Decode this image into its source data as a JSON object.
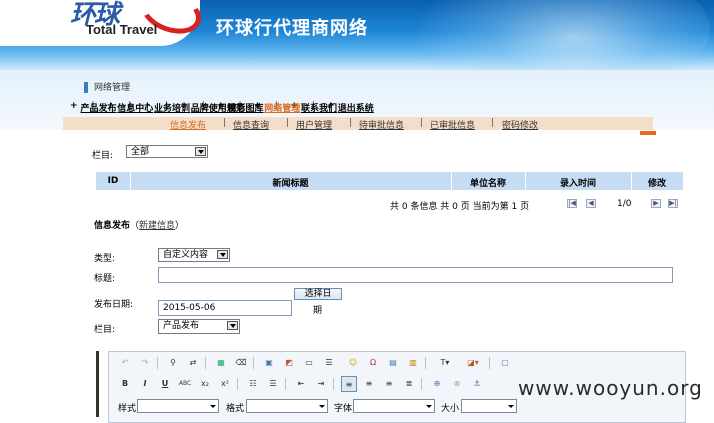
{
  "header": {
    "logo_mark": "环球",
    "logo_text": "Total Travel",
    "site_title": "环球行代理商网络"
  },
  "section_label": "网络管理",
  "nav": [
    {
      "label": "产品发布",
      "active": false
    },
    {
      "label": "信息中心",
      "active": false
    },
    {
      "label": "业务培训",
      "active": false
    },
    {
      "label": "品牌使用规范",
      "active": false
    },
    {
      "label": "精彩图库",
      "active": false
    },
    {
      "label": "网络管理",
      "active": true
    },
    {
      "label": "联系我们",
      "active": false
    },
    {
      "label": "退出系统",
      "active": false
    }
  ],
  "subnav": [
    {
      "label": "信息发布",
      "active": true
    },
    {
      "label": "信息查询",
      "active": false
    },
    {
      "label": "用户管理",
      "active": false
    },
    {
      "label": "待审批信息",
      "active": false
    },
    {
      "label": "已审批信息",
      "active": false
    },
    {
      "label": "密码修改",
      "active": false
    }
  ],
  "filter": {
    "label": "栏目:",
    "value": "全部"
  },
  "table": {
    "columns": [
      "ID",
      "新闻标题",
      "单位名称",
      "录入时间",
      "修改"
    ]
  },
  "pager": {
    "text": "共 0 条信息  共 0 页  当前为第 1 页",
    "page_info": "1/0"
  },
  "form": {
    "heading": "信息发布",
    "new_link": "新建信息",
    "type_label": "类型:",
    "type_value": "自定义内容",
    "title_label": "标题:",
    "title_value": "",
    "date_label": "发布日期:",
    "date_value": "2015-05-06",
    "date_button_line1": "选择日",
    "date_button_line2": "期",
    "column_label": "栏目:",
    "column_value": "产品发布"
  },
  "editor": {
    "row1_icons": [
      "undo-icon",
      "redo-icon",
      "find-icon",
      "replace-icon",
      "table-icon",
      "eraser-icon",
      "image-icon",
      "flash-icon",
      "frame-icon",
      "hr-icon",
      "smiley-icon",
      "special-char-icon",
      "gallery-icon",
      "template-icon",
      "text-color-icon",
      "bg-color-icon",
      "preview-icon"
    ],
    "row2_icons": [
      "bold-icon",
      "italic-icon",
      "underline-icon",
      "strike-icon",
      "subscript-icon",
      "superscript-icon",
      "ordered-list-icon",
      "unordered-list-icon",
      "outdent-icon",
      "indent-icon",
      "align-left-icon",
      "align-center-icon",
      "align-right-icon",
      "justify-icon",
      "link-icon",
      "unlink-icon",
      "anchor-icon"
    ],
    "style_label": "样式",
    "format_label": "格式",
    "font_label": "字体",
    "size_label": "大小"
  },
  "watermark": "www.wooyun.org"
}
